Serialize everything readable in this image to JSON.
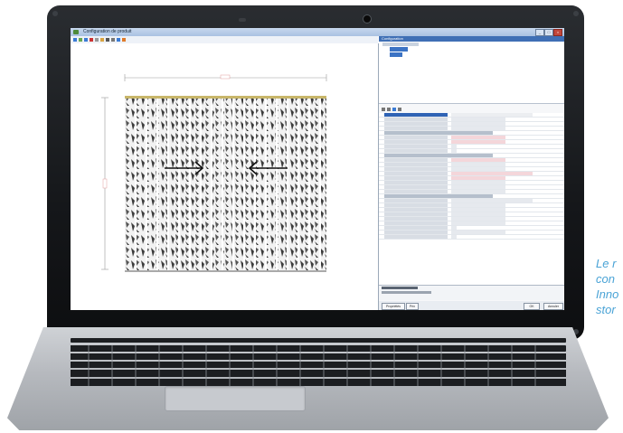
{
  "window": {
    "title": "Configuration de produit",
    "controls": [
      "_",
      "□",
      "×"
    ]
  },
  "panel": {
    "header": "Configuration"
  },
  "dialog_buttons": {
    "ok_label": "OK",
    "cancel_label": "Annuler"
  },
  "bottom_tabs": [
    "Propriétés",
    "Prix"
  ],
  "caption": {
    "lines": [
      "Le r",
      "con",
      "Inno",
      "stor"
    ]
  },
  "colors": {
    "caption": "#4aa3d6",
    "selection": "#2f63b5",
    "titlebar": "#a9c1e2"
  }
}
